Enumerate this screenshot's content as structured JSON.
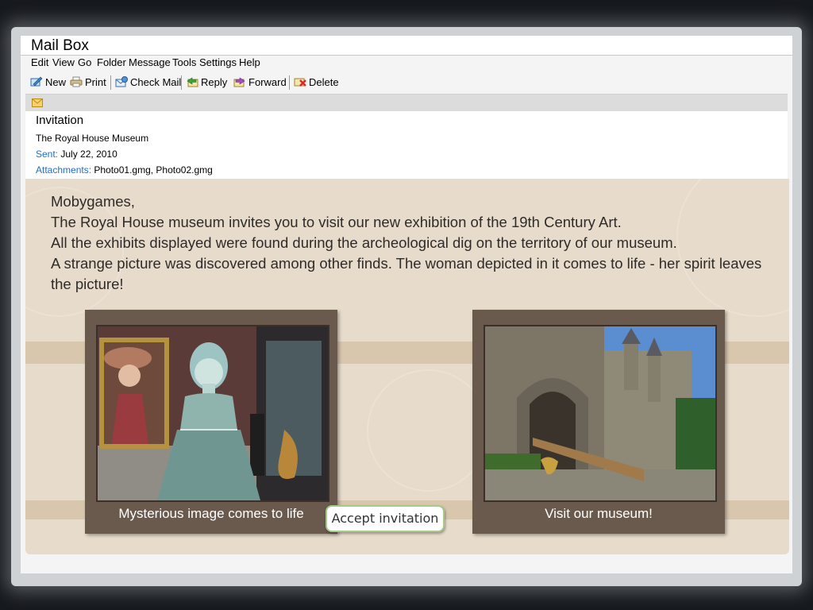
{
  "window": {
    "title": "Mail Box"
  },
  "menu": [
    "Edit",
    "View",
    "Go",
    "Folder",
    "Message",
    "Tools",
    "Settings",
    "Help"
  ],
  "toolbar": {
    "new": "New",
    "print": "Print",
    "check_mail": "Check Mail",
    "reply": "Reply",
    "forward": "Forward",
    "delete": "Delete"
  },
  "message": {
    "subject": "Invitation",
    "from": "The Royal House Museum",
    "sent_label": "Sent:",
    "sent": "July 22, 2010",
    "attachments_label": "Attachments:",
    "attachments": "Photo01.gmg, Photo02.gmg"
  },
  "letter": {
    "greeting": "Mobygames,",
    "p1": "The Royal House museum invites you to visit our new exhibition of the 19th Century Art.",
    "p2": "All the exhibits displayed were found during the archeological dig on the territory of our museum.",
    "p3": "A strange picture was discovered among other finds. The woman depicted in it comes to life - her spirit leaves the picture!"
  },
  "photos": [
    {
      "caption": "Mysterious image comes to life"
    },
    {
      "caption": "Visit our museum!"
    }
  ],
  "actions": {
    "accept": "Accept invitation"
  },
  "colors": {
    "body_bg": "#e7dccb",
    "card_bg": "#6a5a4d",
    "label_blue": "#1e6fc8",
    "accept_border": "#a8c98c"
  }
}
